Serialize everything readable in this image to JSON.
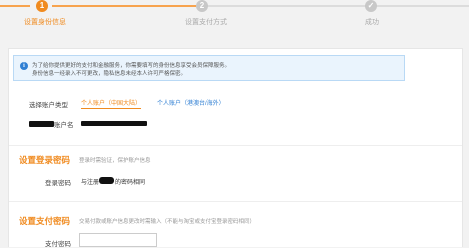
{
  "steps": [
    {
      "number": "1",
      "label": "设置身份信息",
      "state": "active"
    },
    {
      "number": "2",
      "label": "设置支付方式",
      "state": "pending"
    },
    {
      "number": "✓",
      "label": "成功",
      "state": "pending"
    }
  ],
  "notice": {
    "icon": "info-icon",
    "line1": "为了给你提供更好的支付和金融服务，你需要填写的身份信息享受会员保障服务。",
    "line2": "身份信息一经录入不可更改，隐私信息未经本人许可严格保密。"
  },
  "account_type": {
    "label": "选择账户类型",
    "options": [
      {
        "label": "个人账户（中国大陆）",
        "selected": true
      },
      {
        "label": "个人账户（港澳台/海外）",
        "selected": false
      }
    ]
  },
  "account_name": {
    "label_suffix": "账户名",
    "value_redacted": true
  },
  "login_section": {
    "title": "设置登录密码",
    "hint": "登录时需验证，保护账户信息",
    "password_label": "登录密码",
    "password_text_prefix": "与注册",
    "password_text_suffix": "的密码相同"
  },
  "pay_section": {
    "title": "设置支付密码",
    "hint": "交易付款或账户信息更改时需输入（不能与淘宝或支付宝登录密码相同）",
    "password_label": "支付密码"
  },
  "colors": {
    "accent": "#f08b20",
    "link": "#2f7fd3",
    "notice_bg": "#eaf4fd"
  }
}
